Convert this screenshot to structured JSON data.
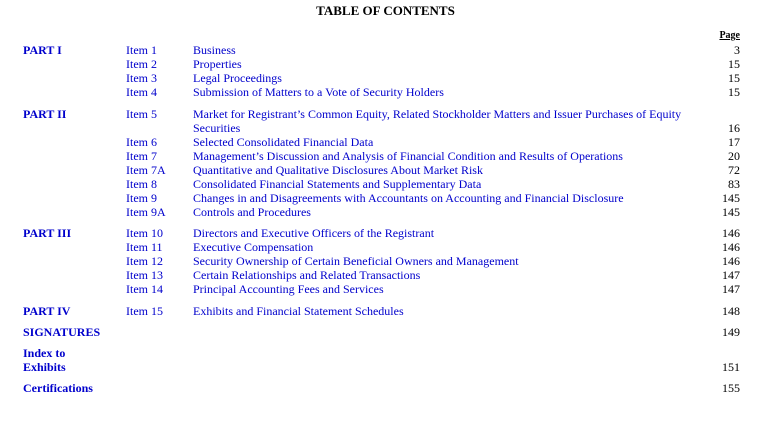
{
  "title": "TABLE OF CONTENTS",
  "page_header": "Page",
  "parts": {
    "part1": "PART I",
    "part2": "PART II",
    "part3": "PART III",
    "part4": "PART IV"
  },
  "items": [
    {
      "item": "Item 1",
      "desc": "Business",
      "page": "3"
    },
    {
      "item": "Item 2",
      "desc": "Properties",
      "page": "15"
    },
    {
      "item": "Item 3",
      "desc": "Legal Proceedings",
      "page": "15"
    },
    {
      "item": "Item 4",
      "desc": "Submission of Matters to a Vote of Security Holders",
      "page": "15"
    },
    {
      "item": "Item 5",
      "desc": "Market for Registrant’s Common Equity, Related Stockholder Matters and Issuer Purchases of Equity Securities",
      "page": "16"
    },
    {
      "item": "Item 6",
      "desc": "Selected Consolidated Financial Data",
      "page": "17"
    },
    {
      "item": "Item 7",
      "desc": "Management’s Discussion and Analysis of Financial Condition and Results of Operations",
      "page": "20"
    },
    {
      "item": "Item 7A",
      "desc": "Quantitative and Qualitative Disclosures About Market Risk",
      "page": "72"
    },
    {
      "item": "Item 8",
      "desc": "Consolidated Financial Statements and Supplementary Data",
      "page": "83"
    },
    {
      "item": "Item 9",
      "desc": "Changes in and Disagreements with Accountants on Accounting and Financial Disclosure",
      "page": "145"
    },
    {
      "item": "Item 9A",
      "desc": "Controls and Procedures",
      "page": "145"
    },
    {
      "item": "Item 10",
      "desc": "Directors and Executive Officers of the Registrant",
      "page": "146"
    },
    {
      "item": "Item 11",
      "desc": "Executive Compensation",
      "page": "146"
    },
    {
      "item": "Item 12",
      "desc": "Security Ownership of Certain Beneficial Owners and Management",
      "page": "146"
    },
    {
      "item": "Item 13",
      "desc": "Certain Relationships and Related Transactions",
      "page": "147"
    },
    {
      "item": "Item 14",
      "desc": "Principal Accounting Fees and Services",
      "page": "147"
    },
    {
      "item": "Item 15",
      "desc": "Exhibits and Financial Statement Schedules",
      "page": "148"
    }
  ],
  "sections": [
    {
      "label": "SIGNATURES",
      "page": "149"
    },
    {
      "label_line1": "Index to",
      "label_line2": "Exhibits",
      "page": "151"
    },
    {
      "label": "Certifications",
      "page": "155"
    }
  ]
}
